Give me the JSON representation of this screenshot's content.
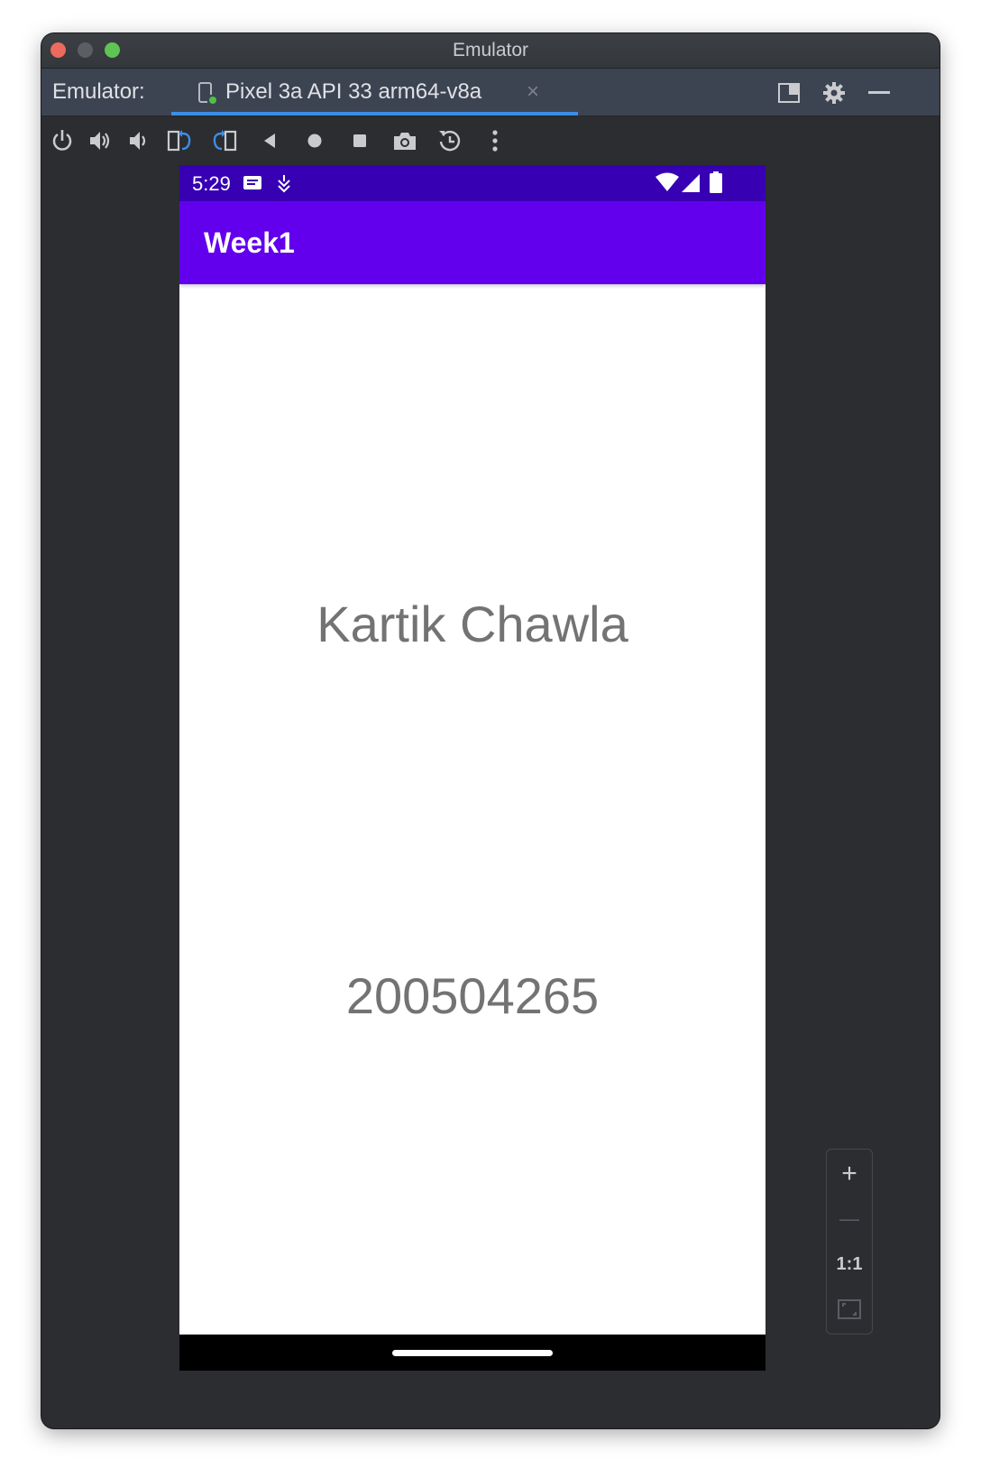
{
  "window": {
    "title": "Emulator"
  },
  "tabbar": {
    "label": "Emulator:",
    "tab_label": "Pixel 3a API 33 arm64-v8a",
    "tab_close_glyph": "×",
    "icons": [
      "layout-icon",
      "gear-icon",
      "minimize-icon"
    ]
  },
  "toolbar": {
    "icons": [
      "power-icon",
      "volume-up-icon",
      "volume-down-icon",
      "rotate-left-icon",
      "rotate-right-icon",
      "back-icon",
      "home-icon",
      "overview-icon",
      "camera-icon",
      "snapshot-icon",
      "more-icon"
    ]
  },
  "phone": {
    "status": {
      "time": "5:29",
      "icons": [
        "notification-message-icon",
        "notification-download-icon",
        "wifi-icon",
        "signal-icon",
        "battery-icon"
      ]
    },
    "app_title": "Week1",
    "name": "Kartik Chawla",
    "student_id": "200504265"
  },
  "zoom": {
    "zoom_in": "+",
    "zoom_out": "—",
    "actual_size": "1:1"
  },
  "colors": {
    "status_bar": "#3700b3",
    "app_bar": "#6200ee",
    "content_text": "#737373",
    "tab_underline": "#3d8ee6",
    "rotate_accent": "#3d8ee6"
  }
}
